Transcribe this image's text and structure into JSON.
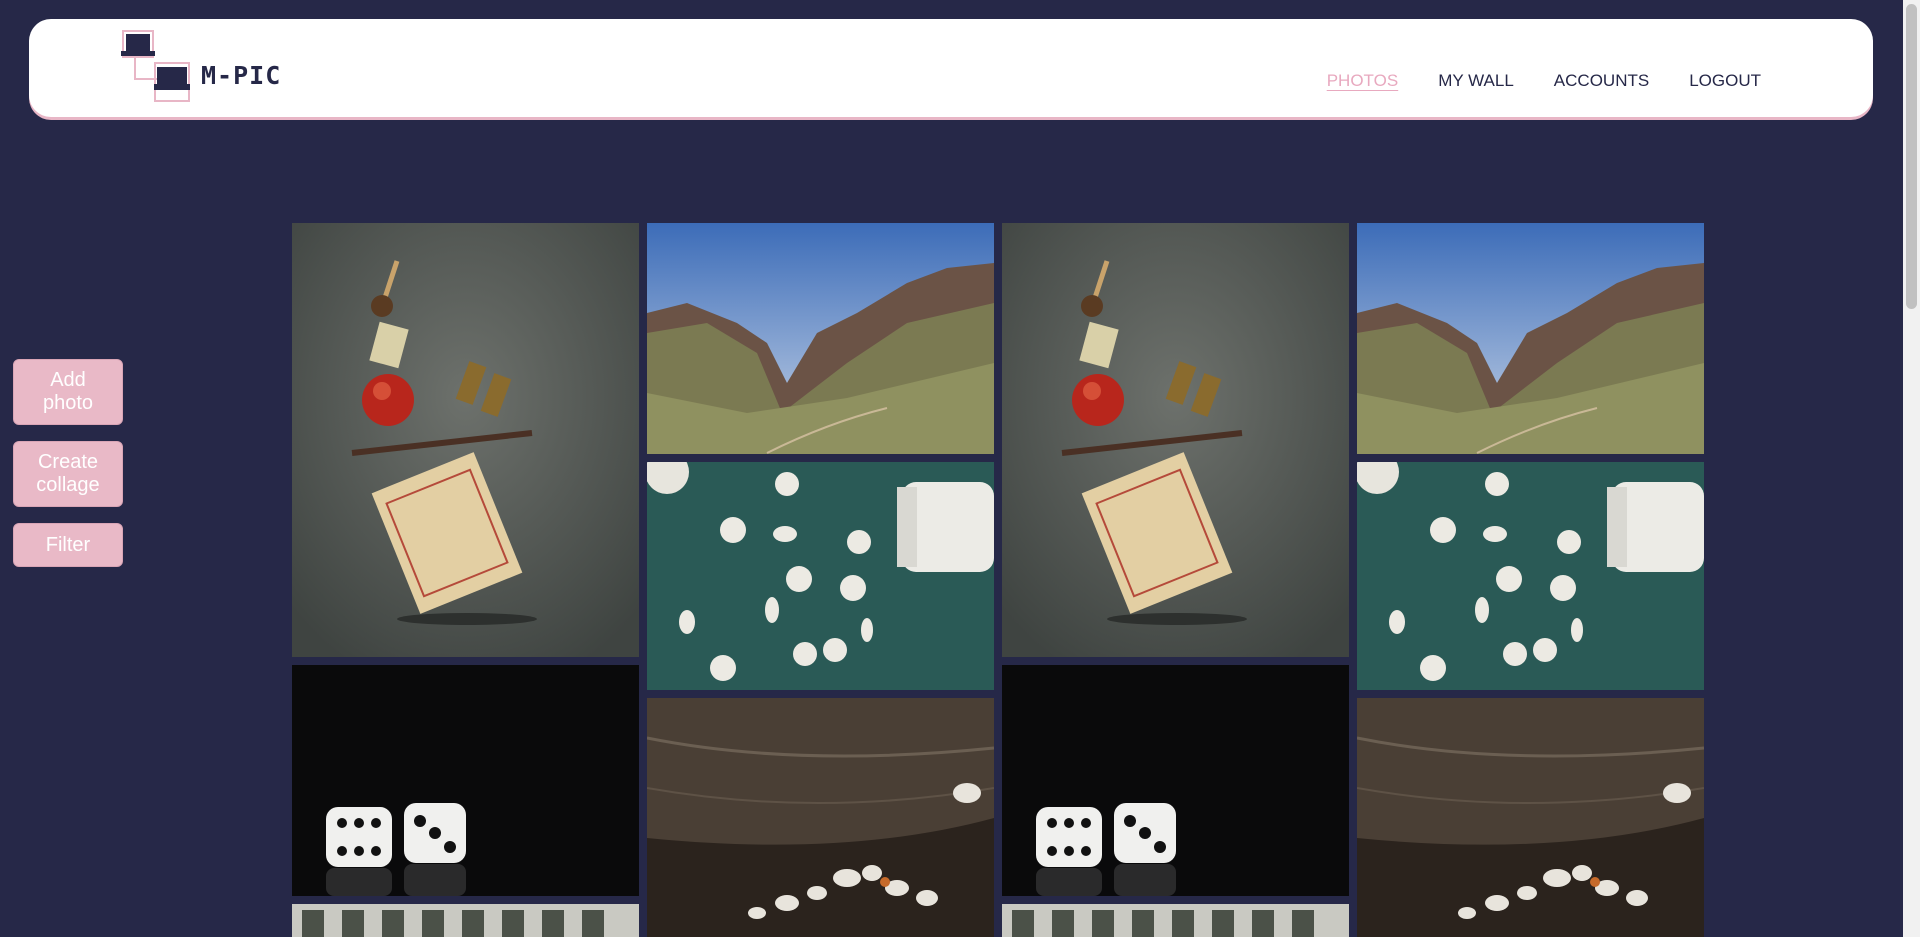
{
  "brand": {
    "name": "M-PIC"
  },
  "nav": {
    "items": [
      {
        "label": "PHOTOS",
        "active": true
      },
      {
        "label": "MY WALL",
        "active": false
      },
      {
        "label": "ACCOUNTS",
        "active": false
      },
      {
        "label": "LOGOUT",
        "active": false
      }
    ]
  },
  "sidebar": {
    "add_photo": "Add photo",
    "create_collage": "Create collage",
    "filter": "Filter"
  },
  "gallery": {
    "photos": [
      {
        "subject": "balancing-still-life"
      },
      {
        "subject": "mountain-canyon"
      },
      {
        "subject": "spilled-pills"
      },
      {
        "subject": "dice-on-black"
      },
      {
        "subject": "seashells-on-rock"
      },
      {
        "subject": "building-facade"
      }
    ]
  },
  "colors": {
    "background": "#262848",
    "accent_pink": "#e9b9c7",
    "header_bg": "#ffffff"
  }
}
